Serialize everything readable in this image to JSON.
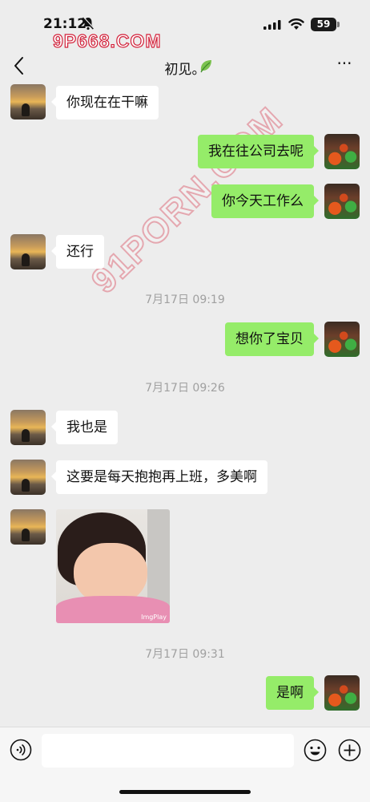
{
  "status_bar": {
    "time": "21:12",
    "battery": "59",
    "watermark": "9P668.COM"
  },
  "header": {
    "title": "初见。",
    "back_icon": "chevron-left-icon",
    "leaf_icon": "leaf-icon",
    "more_icon": "more-icon"
  },
  "overlay_watermark": "91PORN.COM",
  "messages": [
    {
      "side": "in",
      "text": "你现在在干嘛"
    },
    {
      "side": "out",
      "text": "我在往公司去呢"
    },
    {
      "side": "out",
      "text": "你今天工作么"
    },
    {
      "side": "in",
      "text": "还行"
    },
    {
      "timestamp": "7月17日 09:19"
    },
    {
      "side": "out",
      "text": "想你了宝贝"
    },
    {
      "timestamp": "7月17日 09:26"
    },
    {
      "side": "in",
      "text": "我也是"
    },
    {
      "side": "in",
      "text": "这要是每天抱抱再上班，多美啊"
    },
    {
      "side": "in",
      "type": "image",
      "image_tag": "ImgPlay"
    },
    {
      "timestamp": "7月17日 09:31"
    },
    {
      "side": "out",
      "text": "是啊"
    }
  ],
  "input_bar": {
    "voice_icon": "voice-icon",
    "emoji_icon": "emoji-icon",
    "plus_icon": "plus-icon",
    "placeholder": ""
  },
  "colors": {
    "background": "#ededed",
    "incoming_bubble": "#ffffff",
    "outgoing_bubble": "#95ec69",
    "timestamp_text": "#a0a0a0"
  }
}
